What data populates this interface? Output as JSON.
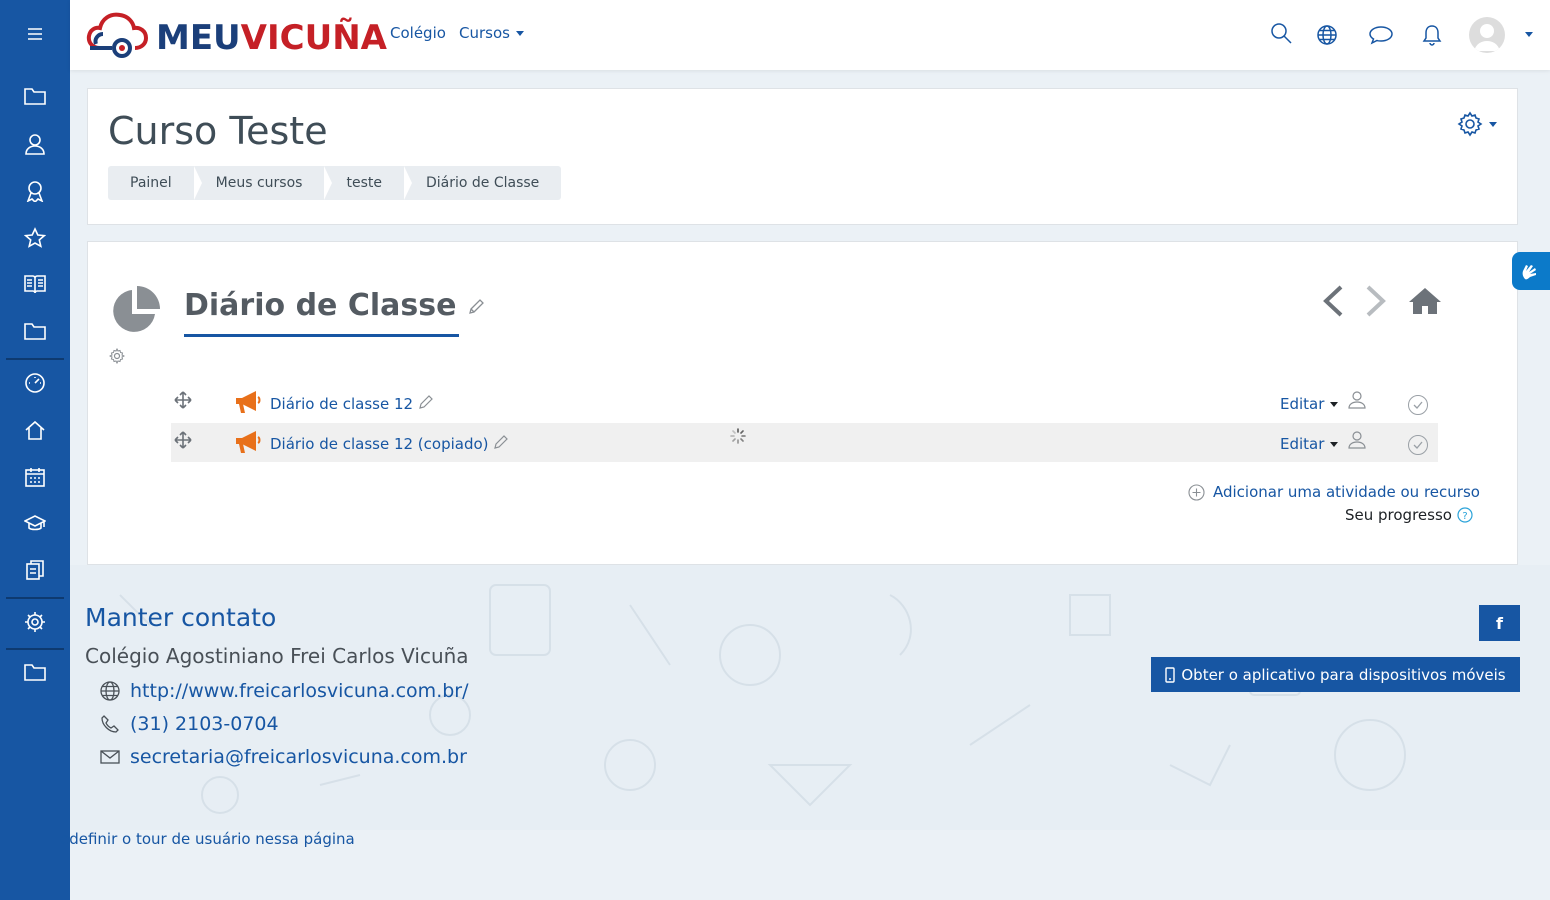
{
  "sidebar": {
    "menu_icon": "hamburger-icon",
    "items": [
      {
        "icon": "folder-icon"
      },
      {
        "icon": "participants-icon"
      },
      {
        "icon": "badge-icon"
      },
      {
        "icon": "star-icon"
      },
      {
        "icon": "book-icon"
      },
      {
        "icon": "folder-icon"
      },
      {
        "icon": "dashboard-icon"
      },
      {
        "icon": "home-icon"
      },
      {
        "icon": "calendar-icon"
      },
      {
        "icon": "graduation-cap-icon"
      },
      {
        "icon": "files-icon"
      },
      {
        "icon": "settings-icon"
      },
      {
        "icon": "folder-icon"
      }
    ]
  },
  "header": {
    "logo_meu": "MEU",
    "logo_vicuna": "VICUÑA",
    "nav_colegio": "Colégio",
    "nav_cursos": "Cursos"
  },
  "page": {
    "course_title": "Curso Teste",
    "breadcrumb": [
      "Painel",
      "Meus cursos",
      "teste",
      "Diário de Classe"
    ]
  },
  "section": {
    "title": "Diário de Classe",
    "activities": [
      {
        "name": "Diário de classe 12",
        "edit_label": "Editar"
      },
      {
        "name": "Diário de classe 12 (copiado)",
        "edit_label": "Editar"
      }
    ],
    "add_activity": "Adicionar uma atividade ou recurso",
    "progress_label": "Seu progresso"
  },
  "footer": {
    "title": "Manter contato",
    "org": "Colégio Agostiniano Frei Carlos Vicuña",
    "website": "http://www.freicarlosvicuna.com.br/",
    "phone": "(31) 2103-0704",
    "email": "secretaria@freicarlosvicuna.com.br",
    "facebook_label": "f",
    "app_button": "Obter o aplicativo para dispositivos móveis",
    "tour_link": "edefinir o tour de usuário nessa página"
  },
  "colors": {
    "primary": "#1756a3",
    "logo_red": "#c52026",
    "logo_blue": "#1b3f7a",
    "activity_orange": "#e8701a"
  }
}
